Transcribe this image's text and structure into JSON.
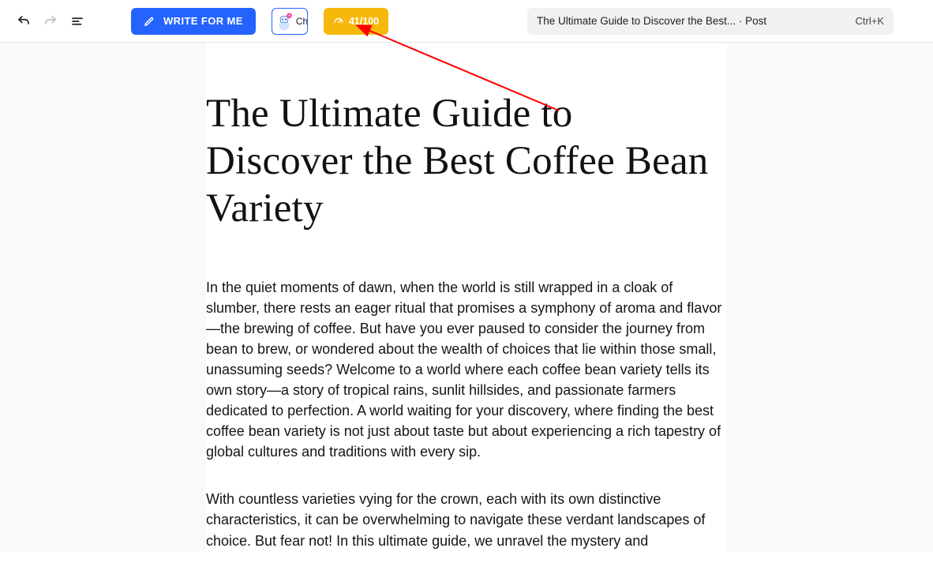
{
  "toolbar": {
    "write_label": "WRITE FOR ME",
    "bot_chip_text": "Ch",
    "score_label": "41/100"
  },
  "search": {
    "doc_label": "The Ultimate Guide to Discover the Best... · Post",
    "shortcut": "Ctrl+K"
  },
  "document": {
    "title": "The Ultimate Guide to Discover the Best Coffee Bean Variety",
    "paragraphs": [
      "In the quiet moments of dawn, when the world is still wrapped in a cloak of slumber, there rests an eager ritual that promises a symphony of aroma and flavor—the brewing of coffee. But have you ever paused to consider the journey from bean to brew, or wondered about the wealth of choices that lie within those small, unassuming seeds? Welcome to a world where each coffee bean variety tells its own story—a story of tropical rains, sunlit hillsides, and passionate farmers dedicated to perfection. A world waiting for your discovery, where finding the best coffee bean variety is not just about taste but about experiencing a rich tapestry of global cultures and traditions with every sip.",
      "With countless varieties vying for the crown, each with its own distinctive characteristics, it can be overwhelming to navigate these verdant landscapes of choice. But fear not! In this ultimate guide, we unravel the mystery and"
    ]
  }
}
